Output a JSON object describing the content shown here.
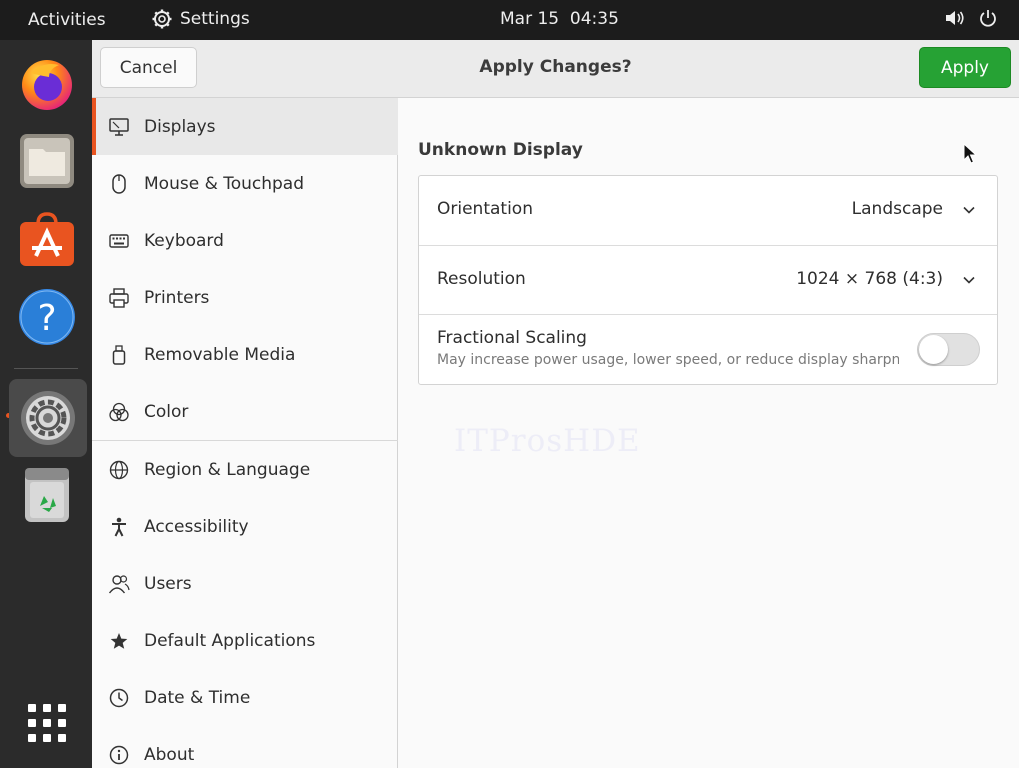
{
  "topbar": {
    "activities": "Activities",
    "app_name": "Settings",
    "clock": "Mar 15  04:35"
  },
  "dock": {
    "items": [
      {
        "name": "firefox-icon"
      },
      {
        "name": "files-icon"
      },
      {
        "name": "app-center-icon"
      },
      {
        "name": "help-icon"
      },
      {
        "name": "settings-icon"
      },
      {
        "name": "trash-icon"
      },
      {
        "name": "show-apps-icon"
      }
    ]
  },
  "headerbar": {
    "cancel_label": "Cancel",
    "title": "Apply Changes?",
    "apply_label": "Apply",
    "apply_color": "#26a234"
  },
  "sidebar": {
    "items": [
      {
        "label": "Displays",
        "icon": "display-icon",
        "selected": true
      },
      {
        "label": "Mouse & Touchpad",
        "icon": "mouse-icon"
      },
      {
        "label": "Keyboard",
        "icon": "keyboard-icon"
      },
      {
        "label": "Printers",
        "icon": "printer-icon"
      },
      {
        "label": "Removable Media",
        "icon": "usb-drive-icon"
      },
      {
        "label": "Color",
        "icon": "color-icon"
      },
      {
        "label": "Region & Language",
        "icon": "globe-icon"
      },
      {
        "label": "Accessibility",
        "icon": "accessibility-icon"
      },
      {
        "label": "Users",
        "icon": "users-icon"
      },
      {
        "label": "Default Applications",
        "icon": "star-icon"
      },
      {
        "label": "Date & Time",
        "icon": "clock-icon"
      },
      {
        "label": "About",
        "icon": "info-icon"
      }
    ],
    "accent_color": "#e95420"
  },
  "display": {
    "heading": "Unknown Display",
    "orientation": {
      "label": "Orientation",
      "value": "Landscape"
    },
    "resolution": {
      "label": "Resolution",
      "value": "1024 × 768 (4:3)"
    },
    "fractional_scaling": {
      "label": "Fractional Scaling",
      "description": "May increase power usage, lower speed, or reduce display sharpness.",
      "enabled": false
    }
  },
  "watermark": "ITProsHDE"
}
